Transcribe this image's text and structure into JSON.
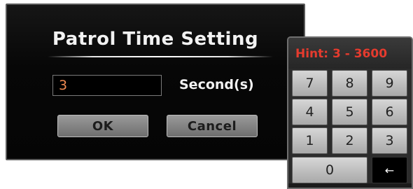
{
  "dialog": {
    "title": "Patrol Time Setting",
    "input_value": "3",
    "unit_label": "Second(s)",
    "ok_label": "OK",
    "cancel_label": "Cancel"
  },
  "keypad": {
    "hint": "Hint: 3 - 3600",
    "keys": [
      "7",
      "8",
      "9",
      "4",
      "5",
      "6",
      "1",
      "2",
      "3",
      "0"
    ],
    "backspace_icon": "left-arrow-icon",
    "backspace_glyph": "←"
  },
  "colors": {
    "dialog_bg": "#070707",
    "input_text": "#f08a52",
    "hint_text": "#e53b2e",
    "button_bg": "#8a8a8a",
    "key_bg": "#c4c4c4"
  }
}
